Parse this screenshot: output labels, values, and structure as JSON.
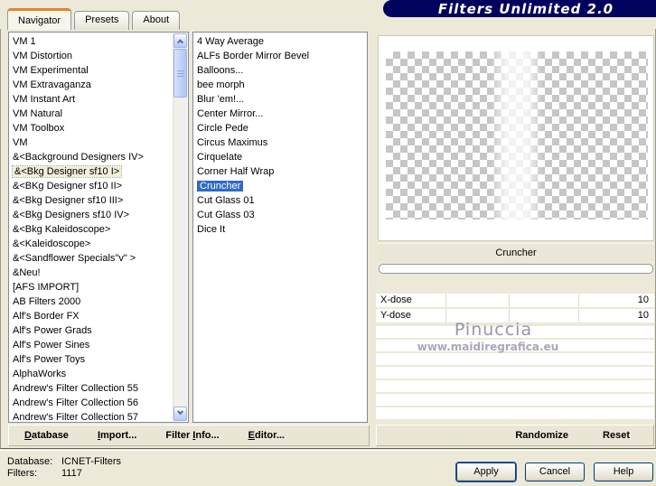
{
  "window": {
    "title": "Filters Unlimited 2.0"
  },
  "tabs": {
    "navigator": "Navigator",
    "presets": "Presets",
    "about": "About"
  },
  "category_list": {
    "selected_index": 9,
    "items": [
      "VM 1",
      "VM Distortion",
      "VM Experimental",
      "VM Extravaganza",
      "VM Instant Art",
      "VM Natural",
      "VM Toolbox",
      "VM",
      "&<Background Designers IV>",
      "&<Bkg Designer sf10 I>",
      "&<BKg Designer sf10 II>",
      "&<Bkg Designer sf10 III>",
      "&<Bkg Designers sf10 IV>",
      "&<Bkg Kaleidoscope>",
      "&<Kaleidoscope>",
      "&<Sandflower Specials\"v\" >",
      "&Neu!",
      "[AFS IMPORT]",
      "AB Filters 2000",
      "Alf's Border FX",
      "Alf's Power Grads",
      "Alf's Power Sines",
      "Alf's Power Toys",
      "AlphaWorks",
      "Andrew's Filter Collection 55",
      "Andrew's Filter Collection 56",
      "Andrew's Filter Collection 57"
    ]
  },
  "filter_list": {
    "selected_index": 10,
    "items": [
      "4 Way Average",
      "ALFs Border Mirror Bevel",
      "Balloons...",
      "bee morph",
      "Blur 'em!...",
      "Center Mirror...",
      "Circle Pede",
      "Circus Maximus",
      "Cirquelate",
      "Corner Half Wrap",
      "Cruncher",
      "Cut Glass 01",
      "Cut Glass 03",
      "Dice It"
    ]
  },
  "preview": {
    "filter_name": "Cruncher"
  },
  "parameters": [
    {
      "label": "X-dose",
      "value": "10"
    },
    {
      "label": "Y-dose",
      "value": "10"
    }
  ],
  "watermark": {
    "name": "Pinuccia",
    "url": "www.maidiregrafica.eu"
  },
  "toolbar": {
    "database": {
      "pre": "",
      "key": "D",
      "post": "atabase"
    },
    "import": {
      "pre": "",
      "key": "I",
      "post": "mport..."
    },
    "filter_info": {
      "pre": "Filter ",
      "key": "I",
      "post": "nfo..."
    },
    "editor": {
      "pre": "",
      "key": "E",
      "post": "ditor..."
    },
    "randomize": "Randomize",
    "reset": "Reset"
  },
  "status": {
    "database_label": "Database:",
    "database_value": "ICNET-Filters",
    "filters_label": "Filters:",
    "filters_value": "1117"
  },
  "buttons": {
    "apply": "Apply",
    "cancel": "Cancel",
    "help": "Help"
  },
  "colors": {
    "dialog_bg": "#ece9d8",
    "title_bg": "#01015e",
    "selection_blue": "#316ac5",
    "tab_accent_orange": "#e0872c",
    "checker_gray": "#c6c6c6"
  }
}
